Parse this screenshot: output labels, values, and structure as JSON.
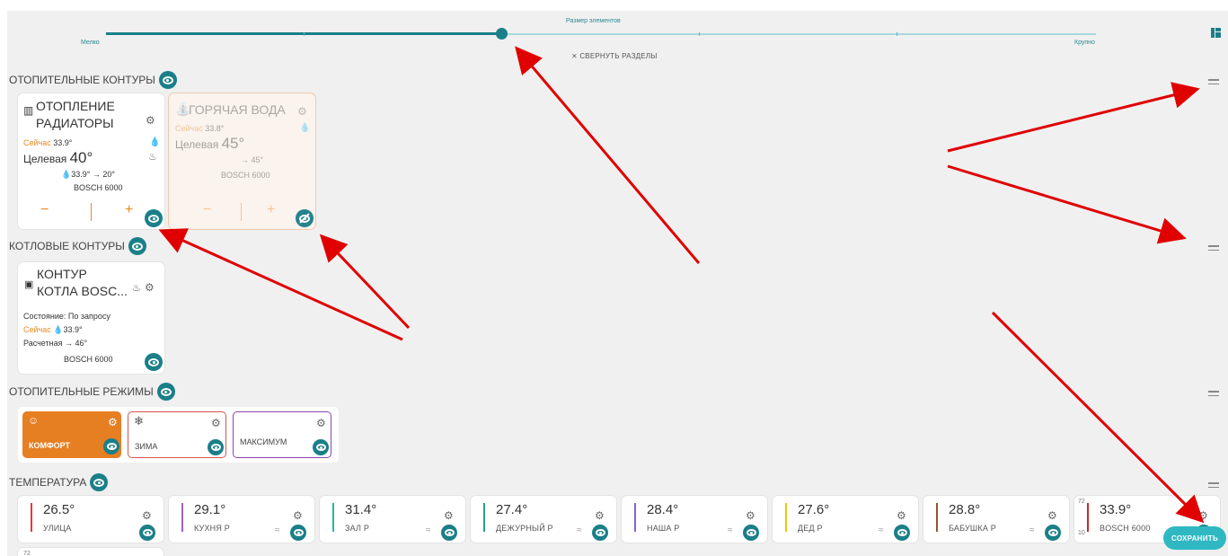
{
  "slider": {
    "caption": "Размер элементов",
    "min_label": "Мелко",
    "max_label": "Крупно",
    "level_fraction": 0.4
  },
  "collapse_label": "СВЕРНУТЬ РАЗДЕЛЫ",
  "sections": {
    "heating": "ОТОПИТЕЛЬНЫЕ КОНТУРЫ",
    "boiler": "КОТЛОВЫЕ КОНТУРЫ",
    "modes": "ОТОПИТЕЛЬНЫЕ РЕЖИМЫ",
    "temperature": "ТЕМПЕРАТУРА"
  },
  "heating_cards": [
    {
      "title1": "ОТОПЛЕНИЕ",
      "title2": "РАДИАТОРЫ",
      "now_label": "Сейчас",
      "now": "33.9°",
      "target_label": "Целевая",
      "target": "40°",
      "flow": "33.9° → 20°",
      "device": "BOSCH 6000",
      "minus": "−",
      "plus": "+"
    },
    {
      "title": "ГОРЯЧАЯ ВОДА",
      "now_label": "Сейчас",
      "now": "33.8°",
      "target_label": "Целевая",
      "target": "45°",
      "flow": "→ 45°",
      "device": "BOSCH 6000",
      "minus": "−",
      "plus": "+"
    }
  ],
  "boiler_card": {
    "title1": "КОНТУР",
    "title2": "КОТЛА BOSC...",
    "state": "Состояние: По запросу",
    "now_label": "Сейчас",
    "now": "33.9°",
    "calc": "Расчетная → 46°",
    "device": "BOSCH 6000"
  },
  "modes": [
    {
      "label": "КОМФОРТ",
      "color": "#e67e22"
    },
    {
      "label": "ЗИМА",
      "color": "#d9534f"
    },
    {
      "label": "МАКСИМУМ",
      "color": "#8e44ad"
    }
  ],
  "temps": [
    {
      "value": "26.5°",
      "name": "УЛИЦА",
      "color": "#e53935"
    },
    {
      "value": "29.1°",
      "name": "КУХНЯ Р",
      "color": "#9c5fc7"
    },
    {
      "value": "31.4°",
      "name": "ЗАЛ Р",
      "color": "#26b5a8"
    },
    {
      "value": "27.4°",
      "name": "ДЕЖУРНЫЙ Р",
      "color": "#2a9d8f"
    },
    {
      "value": "28.4°",
      "name": "НАША Р",
      "color": "#8b5ecf"
    },
    {
      "value": "27.6°",
      "name": "ДЕД Р",
      "color": "#f4c20d"
    },
    {
      "value": "28.8°",
      "name": "БАБУШКА Р",
      "color": "#8b5a2b"
    },
    {
      "value": "33.9°",
      "name": "BOSCH 6000",
      "color": "#c62828",
      "max": "72",
      "min": "10"
    }
  ],
  "extra_card_max": "72",
  "save_label": "СОХРАНИТЬ",
  "accent": "#1a7f89",
  "arrow_color": "#e00000"
}
